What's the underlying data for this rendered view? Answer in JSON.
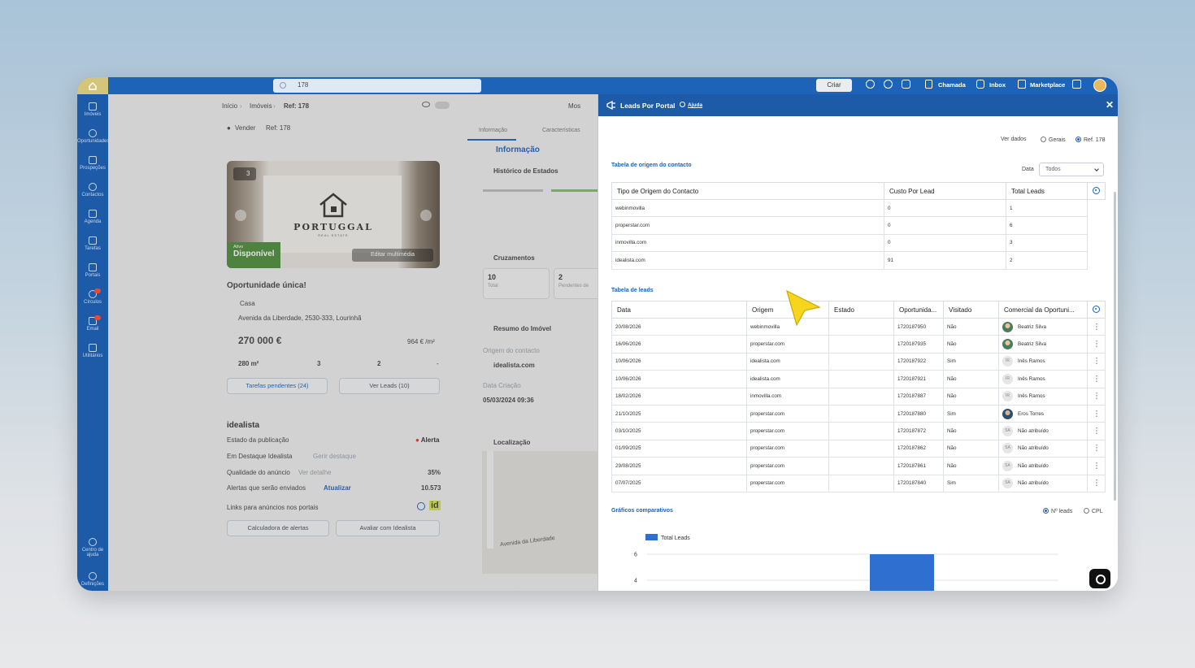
{
  "topbar": {
    "search_value": "178",
    "create_label": "Criar",
    "call_label": "Chamada",
    "inbox_label": "Inbox",
    "marketplace_label": "Marketplace"
  },
  "sidebar": {
    "items": [
      {
        "label": "Imóveis",
        "icon": "house-icon"
      },
      {
        "label": "Oportunidades",
        "icon": "people-icon"
      },
      {
        "label": "Prospeções",
        "icon": "list-icon"
      },
      {
        "label": "Contactos",
        "icon": "contact-icon"
      },
      {
        "label": "Agenda",
        "icon": "calendar-icon"
      },
      {
        "label": "Tarefas",
        "icon": "task-icon"
      },
      {
        "label": "Portais",
        "icon": "portal-icon"
      },
      {
        "label": "Círculos",
        "icon": "circle-icon"
      },
      {
        "label": "Email",
        "icon": "mail-icon"
      },
      {
        "label": "Utilitários",
        "icon": "tool-icon"
      },
      {
        "label": "Centro de ajuda",
        "icon": "help-icon"
      },
      {
        "label": "Definições",
        "icon": "settings-icon"
      }
    ]
  },
  "background": {
    "breadcrumb": [
      "Início",
      "Imóveis",
      "Ref: 178"
    ],
    "mode": "Vender",
    "ref": "Ref: 178",
    "photo_count": "3",
    "brand": "PORTUGGAL",
    "brand_sub": "REAL ESTATE",
    "status_small": "Ativo",
    "status": "Disponível",
    "edit_media": "Editar multimédia",
    "title": "Oportunidade única!",
    "type": "Casa",
    "address": "Avenida da Liberdade, 2530-333, Lourinhã",
    "price": "270 000 €",
    "price_per_m2": "964 € /m²",
    "area": "280 m²",
    "rooms": "3",
    "baths": "2",
    "extra": "-",
    "pending_tasks": "Tarefas pendentes (24)",
    "view_leads": "Ver Leads (10)",
    "idealista": "idealista",
    "pub_state_label": "Estado da publicação",
    "pub_state_value": "Alerta",
    "highlight_label": "Em Destaque Idealista",
    "highlight_value": "Gerir destaque",
    "quality_label": "Qualidade do anúncio",
    "quality_link": "Ver detalhe",
    "quality_value": "35%",
    "alerts_label": "Alertas que serão enviados",
    "alerts_link": "Atualizar",
    "alerts_value": "10.573",
    "links_label": "Links para anúncios nos portais",
    "alerts_calc": "Calculadora de alertas",
    "evaluate": "Avaliar com Idealista",
    "tab_info": "Informação",
    "tab_features": "Características",
    "info_title": "Informação",
    "history_title": "Histórico de Estados",
    "cross_title": "Cruzamentos",
    "cross_total_n": "10",
    "cross_total_l": "Total",
    "cross_pending_n": "2",
    "cross_pending_l": "Pendentes de",
    "summary_title": "Resumo do Imóvel",
    "origin_label": "Origem do contacto",
    "origin_value": "idealista.com",
    "created_label": "Data Criação",
    "created_value": "05/03/2024 09:36",
    "location_title": "Localização",
    "map_street": "Avenida da Liberdade",
    "show_label": "Mos"
  },
  "panel": {
    "title": "Leads Por Portal",
    "help": "Ajuda",
    "view_label": "Ver dados",
    "view_options": [
      "Gerais",
      "Ref. 178"
    ],
    "origin_section": "Tabela de origem do contacto",
    "date_label": "Data",
    "date_value": "Todos",
    "origin_headers": [
      "Tipo de Origem do Contacto",
      "Custo Por Lead",
      "Total Leads"
    ],
    "origin_rows": [
      [
        "webinmovilla",
        "0",
        "1"
      ],
      [
        "properstar.com",
        "0",
        "6"
      ],
      [
        "inmovilla.com",
        "0",
        "3"
      ],
      [
        "idealista.com",
        "91",
        "2"
      ]
    ],
    "leads_section": "Tabela de leads",
    "leads_headers": [
      "Data",
      "Origem",
      "Estado",
      "Oportunida...",
      "Visitado",
      "Comercial da Oportuni..."
    ],
    "leads_rows": [
      [
        "20/08/2026",
        "webinmovilla",
        "",
        "1720187950",
        "Não",
        "Beatriz Silva",
        "photo1"
      ],
      [
        "16/06/2026",
        "properstar.com",
        "",
        "1720187935",
        "Não",
        "Beatriz Silva",
        "photo1"
      ],
      [
        "10/06/2026",
        "idealista.com",
        "",
        "1720187922",
        "Sim",
        "Inês Ramos",
        "IR"
      ],
      [
        "10/06/2026",
        "idealista.com",
        "",
        "1720187921",
        "Não",
        "Inês Ramos",
        "IR"
      ],
      [
        "18/02/2026",
        "inmovilla.com",
        "",
        "1720187887",
        "Não",
        "Inês Ramos",
        "IR"
      ],
      [
        "21/10/2025",
        "properstar.com",
        "",
        "1720187880",
        "Sim",
        "Eros Torres",
        "photo2"
      ],
      [
        "03/10/2025",
        "properstar.com",
        "",
        "1720187872",
        "Não",
        "Não atribuído",
        "SA"
      ],
      [
        "01/09/2025",
        "properstar.com",
        "",
        "1720187862",
        "Não",
        "Não atribuído",
        "SA"
      ],
      [
        "29/08/2025",
        "properstar.com",
        "",
        "1720187861",
        "Não",
        "Não atribuído",
        "SA"
      ],
      [
        "07/07/2025",
        "properstar.com",
        "",
        "1720187840",
        "Sim",
        "Não atribuído",
        "SA"
      ]
    ],
    "charts_section": "Gráficos comparativos",
    "chart_options": [
      "Nº leads",
      "CPL"
    ]
  },
  "chart_data": {
    "type": "bar",
    "title": "",
    "series": [
      {
        "name": "Total Leads",
        "values": [
          6
        ]
      }
    ],
    "categories": [
      ""
    ],
    "yticks": [
      6,
      4
    ],
    "ylim": [
      0,
      6
    ],
    "legend": "top-left",
    "grid": true,
    "color": "#2f6fd0"
  }
}
